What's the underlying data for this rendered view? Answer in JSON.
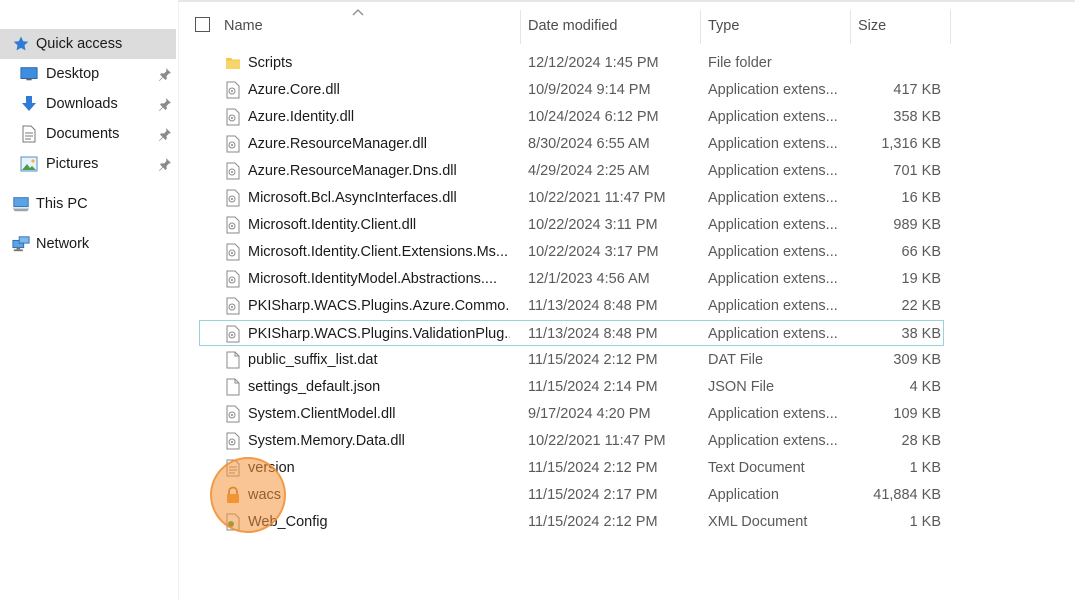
{
  "navigation": {
    "items": [
      {
        "label": "Quick access",
        "icon": "star-icon",
        "selected": true,
        "pinned": false
      },
      {
        "label": "Desktop",
        "icon": "desktop-icon",
        "selected": false,
        "pinned": true
      },
      {
        "label": "Downloads",
        "icon": "download-arrow-icon",
        "selected": false,
        "pinned": true
      },
      {
        "label": "Documents",
        "icon": "document-icon",
        "selected": false,
        "pinned": true
      },
      {
        "label": "Pictures",
        "icon": "pictures-icon",
        "selected": false,
        "pinned": true
      },
      {
        "label": "This PC",
        "icon": "computer-icon",
        "selected": false,
        "pinned": false
      },
      {
        "label": "Network",
        "icon": "network-icon",
        "selected": false,
        "pinned": false
      }
    ]
  },
  "columns": {
    "name": "Name",
    "date": "Date modified",
    "type": "Type",
    "size": "Size"
  },
  "files": [
    {
      "name": "Scripts",
      "date": "12/12/2024 1:45 PM",
      "type": "File folder",
      "size": "",
      "icon": "folder-icon"
    },
    {
      "name": "Azure.Core.dll",
      "date": "10/9/2024 9:14 PM",
      "type": "Application extens...",
      "size": "417 KB",
      "icon": "dll-file-icon"
    },
    {
      "name": "Azure.Identity.dll",
      "date": "10/24/2024 6:12 PM",
      "type": "Application extens...",
      "size": "358 KB",
      "icon": "dll-file-icon"
    },
    {
      "name": "Azure.ResourceManager.dll",
      "date": "8/30/2024 6:55 AM",
      "type": "Application extens...",
      "size": "1,316 KB",
      "icon": "dll-file-icon"
    },
    {
      "name": "Azure.ResourceManager.Dns.dll",
      "date": "4/29/2024 2:25 AM",
      "type": "Application extens...",
      "size": "701 KB",
      "icon": "dll-file-icon"
    },
    {
      "name": "Microsoft.Bcl.AsyncInterfaces.dll",
      "date": "10/22/2021 11:47 PM",
      "type": "Application extens...",
      "size": "16 KB",
      "icon": "dll-file-icon"
    },
    {
      "name": "Microsoft.Identity.Client.dll",
      "date": "10/22/2024 3:11 PM",
      "type": "Application extens...",
      "size": "989 KB",
      "icon": "dll-file-icon"
    },
    {
      "name": "Microsoft.Identity.Client.Extensions.Ms...",
      "date": "10/22/2024 3:17 PM",
      "type": "Application extens...",
      "size": "66 KB",
      "icon": "dll-file-icon"
    },
    {
      "name": "Microsoft.IdentityModel.Abstractions....",
      "date": "12/1/2023 4:56 AM",
      "type": "Application extens...",
      "size": "19 KB",
      "icon": "dll-file-icon"
    },
    {
      "name": "PKISharp.WACS.Plugins.Azure.Commo...",
      "date": "11/13/2024 8:48 PM",
      "type": "Application extens...",
      "size": "22 KB",
      "icon": "dll-file-icon"
    },
    {
      "name": "PKISharp.WACS.Plugins.ValidationPlug...",
      "date": "11/13/2024 8:48 PM",
      "type": "Application extens...",
      "size": "38 KB",
      "icon": "dll-file-icon"
    },
    {
      "name": "public_suffix_list.dat",
      "date": "11/15/2024 2:12 PM",
      "type": "DAT File",
      "size": "309 KB",
      "icon": "blank-file-icon"
    },
    {
      "name": "settings_default.json",
      "date": "11/15/2024 2:14 PM",
      "type": "JSON File",
      "size": "4 KB",
      "icon": "blank-file-icon"
    },
    {
      "name": "System.ClientModel.dll",
      "date": "9/17/2024 4:20 PM",
      "type": "Application extens...",
      "size": "109 KB",
      "icon": "dll-file-icon"
    },
    {
      "name": "System.Memory.Data.dll",
      "date": "10/22/2021 11:47 PM",
      "type": "Application extens...",
      "size": "28 KB",
      "icon": "dll-file-icon"
    },
    {
      "name": "version",
      "date": "11/15/2024 2:12 PM",
      "type": "Text Document",
      "size": "1 KB",
      "icon": "text-file-icon"
    },
    {
      "name": "wacs",
      "date": "11/15/2024 2:17 PM",
      "type": "Application",
      "size": "41,884 KB",
      "icon": "lock-app-icon"
    },
    {
      "name": "Web_Config",
      "date": "11/15/2024 2:12 PM",
      "type": "XML Document",
      "size": "1 KB",
      "icon": "xml-file-icon"
    }
  ],
  "focused_row_index": 10,
  "colors": {
    "nav_selected": "#dcdcdc",
    "focus_border": "#99d1dd",
    "click_highlight": "#f4963c",
    "folder": "#f5c84b",
    "accent_blue": "#2f7bd6"
  }
}
